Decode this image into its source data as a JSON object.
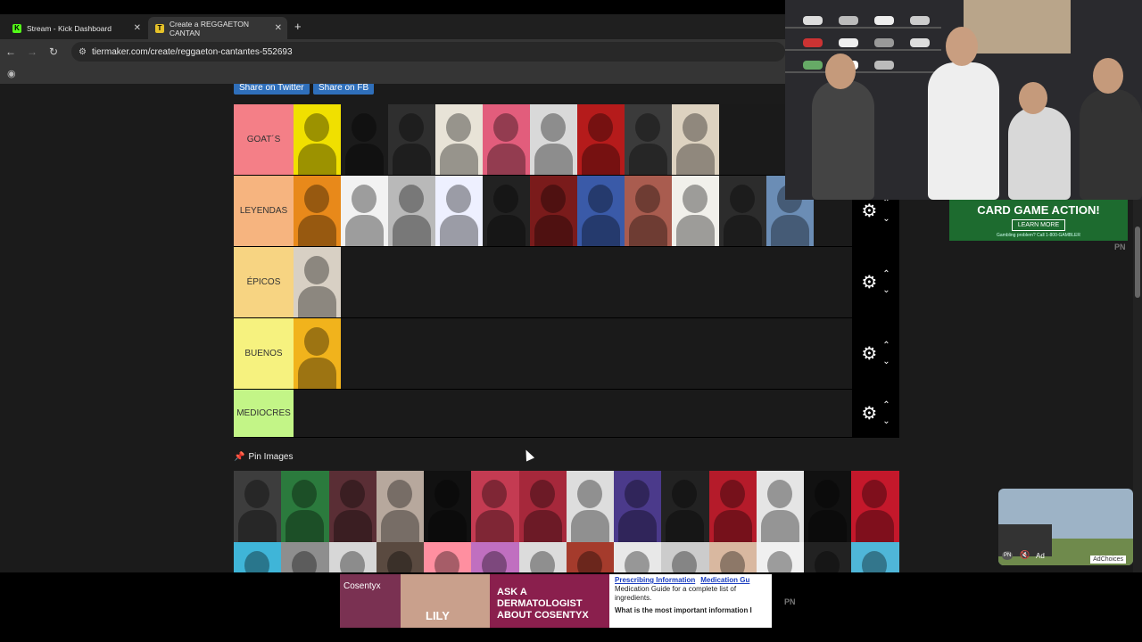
{
  "browser": {
    "tabs": [
      {
        "title": "Stream - Kick Dashboard",
        "favicon": "K"
      },
      {
        "title": "Create a REGGAETON CANTAN",
        "favicon": "T"
      }
    ],
    "new_tab": "+",
    "url": "tiermaker.com/create/reggaeton-cantantes-552693"
  },
  "share": {
    "twitter": "Share on Twitter",
    "facebook": "Share on FB"
  },
  "tiers": [
    {
      "label": "GOAT´S",
      "color": "#f47f87",
      "items": [
        "#f0e000",
        "#1b1b1b",
        "#2f2f2f",
        "#e8e3d7",
        "#e25d7c",
        "#d9d9d9",
        "#b51b1b",
        "#3b3b3b",
        "#ddd2c0"
      ]
    },
    {
      "label": "LEYENDAS",
      "color": "#f6b47f",
      "items": [
        "#e8891a",
        "#f2f2f2",
        "#b9b9b9",
        "#eef0ff",
        "#222",
        "#7a1b1b",
        "#3a5aa8",
        "#a95c4f",
        "#f1f0eb",
        "#2c2c2c",
        "#6b8db5"
      ]
    },
    {
      "label": "ÉPICOS",
      "color": "#f7d482",
      "items": [
        "#d8d0c4"
      ]
    },
    {
      "label": "BUENOS",
      "color": "#f6f27f",
      "items": [
        "#f1b31c"
      ]
    },
    {
      "label": "MEDIOCRES",
      "color": "#c3f587",
      "items": []
    }
  ],
  "pin_images_label": "Pin Images",
  "pool_colors": [
    "#3d3d3d",
    "#2b7a3d",
    "#5a2e35",
    "#b7a89d",
    "#111",
    "#c43b52",
    "#a6283b",
    "#ddd",
    "#4b3a8b",
    "#222",
    "#b51b2a",
    "#e5e5e5",
    "#111",
    "#c4182b",
    "#3fb5d8",
    "#8e8e8e",
    "#d7d7d7",
    "#5a4a40",
    "#ff8fa0",
    "#c06fc0",
    "#dcdcdc",
    "#a53b2c",
    "#e8e8e8",
    "#ccc",
    "#d9b8a0",
    "#f0f0f0",
    "#222",
    "#4fb6d8"
  ],
  "ads": {
    "right_title": "CARD GAME ACTION!",
    "right_button": "LEARN MORE",
    "right_small": "Gambling problem? Call 1-800-GAMBLER",
    "pn": "PN",
    "video_ad_label": "Ad",
    "adchoices": "AdChoices",
    "cosentyx_brand": "Cosentyx",
    "cosentyx_headline": "ASK A DERMATOLOGIST ABOUT COSENTYX",
    "cosentyx_caption": "LILY",
    "cosentyx_links": [
      "Prescribing Information",
      "Medication Gu"
    ],
    "cosentyx_body1": "Medication Guide for a complete list of ingredients.",
    "cosentyx_body2": "What is the most important information I"
  },
  "icons": {
    "gear": "⚙",
    "up": "⌃",
    "down": "⌄"
  }
}
